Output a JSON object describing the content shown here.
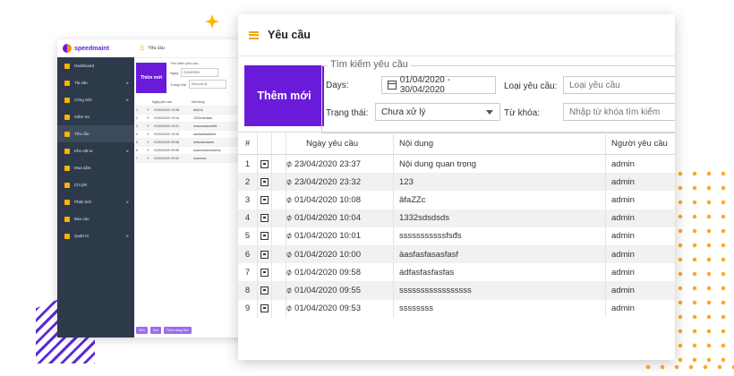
{
  "back_window": {
    "brand": "speedmaint",
    "header_title": "Yêu cầu",
    "new_button": "Thêm mới",
    "search_legend": "Tìm kiếm yêu cầu",
    "days_label": "Ngày",
    "days_value": "01/04/2020",
    "status_label": "Trạng thái",
    "status_value": "Chưa xử lý",
    "col_date": "Ngày yêu cầu",
    "col_content": "Nội dung",
    "nav": [
      "Dashboard",
      "Tài sản",
      "Công việc",
      "Kiểm tra",
      "Yêu cầu",
      "Kho vật tư",
      "Mua sắm",
      "Chi phí",
      "Phân tích",
      "Báo cáo",
      "Quản trị"
    ],
    "rows": [
      {
        "n": "1",
        "date": "01/04/2020 10:08",
        "text": "âfaZZc"
      },
      {
        "n": "2",
        "date": "01/04/2020 10:04",
        "text": "1332sdsdsds"
      },
      {
        "n": "3",
        "date": "01/04/2020 10:01",
        "text": "sssssssssssfsđs"
      },
      {
        "n": "4",
        "date": "01/04/2020 10:00",
        "text": "àasfasfasasfasf"
      },
      {
        "n": "5",
        "date": "01/04/2020 09:58",
        "text": "ádfasfasfasfas"
      },
      {
        "n": "6",
        "date": "01/04/2020 09:55",
        "text": "sssssssssssssssss"
      },
      {
        "n": "7",
        "date": "01/04/2020 09:53",
        "text": "ssssssss"
      }
    ],
    "footer_buttons": [
      "Sửa",
      "Xoá",
      "Thêm công việc"
    ]
  },
  "app": {
    "title": "Yêu cầu",
    "new_button": "Thêm mới",
    "search": {
      "legend": "Tìm kiếm yêu cầu",
      "days_label": "Days:",
      "days_value": "01/04/2020 - 30/04/2020",
      "type_label": "Loại yêu cầu:",
      "type_placeholder": "Loại yêu cầu",
      "status_label": "Trạng thái:",
      "status_value": "Chưa xử lý",
      "keyword_label": "Từ khóa:",
      "keyword_placeholder": "Nhập từ khóa tìm kiếm"
    },
    "table": {
      "headers": {
        "num": "#",
        "date": "Ngày yêu cầu",
        "content": "Nội dung",
        "requester": "Người yêu cầu"
      },
      "rows": [
        {
          "n": "1",
          "date": "23/04/2020 23:37",
          "content": "Nội dung quan trọng",
          "user": "admin"
        },
        {
          "n": "2",
          "date": "23/04/2020 23:32",
          "content": "123",
          "user": "admin"
        },
        {
          "n": "3",
          "date": "01/04/2020 10:08",
          "content": "âfaZZc",
          "user": "admin"
        },
        {
          "n": "4",
          "date": "01/04/2020 10:04",
          "content": "1332sdsdsds",
          "user": "admin"
        },
        {
          "n": "5",
          "date": "01/04/2020 10:01",
          "content": "sssssssssssfsđs",
          "user": "admin"
        },
        {
          "n": "6",
          "date": "01/04/2020 10:00",
          "content": "àasfasfasasfasf",
          "user": "admin"
        },
        {
          "n": "7",
          "date": "01/04/2020 09:58",
          "content": "ádfasfasfasfas",
          "user": "admin"
        },
        {
          "n": "8",
          "date": "01/04/2020 09:55",
          "content": "sssssssssssssssss",
          "user": "admin"
        },
        {
          "n": "9",
          "date": "01/04/2020 09:53",
          "content": "ssssssss",
          "user": "admin"
        }
      ]
    }
  },
  "colors": {
    "primary": "#6a1bd9",
    "accent": "#f2a800",
    "sidebar": "#2d3a4a"
  }
}
